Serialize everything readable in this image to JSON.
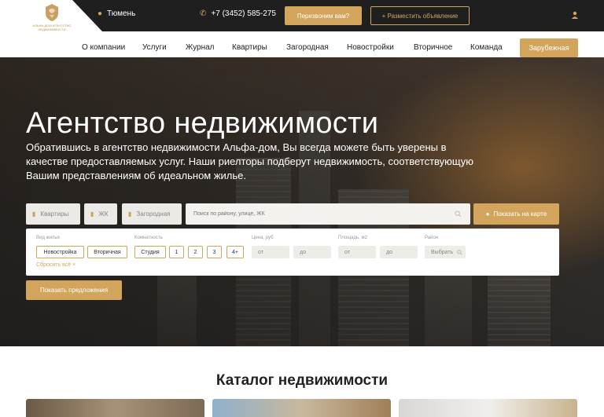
{
  "brand": {
    "logo_caption": "АЛЬФА-ДОМ АГЕНТСТВО НЕДВИЖИМОСТИ",
    "accent": "#d3a55c"
  },
  "topbar": {
    "city": "Тюмень",
    "phone": "+7 (3452) 585-275",
    "callback_label": "Перезвоним вам?",
    "post_label": "+ Разместить объявление"
  },
  "nav": {
    "items": [
      "О компании",
      "Услуги",
      "Журнал",
      "Квартиры",
      "Загородная",
      "Новостройки",
      "Вторичное",
      "Команда"
    ],
    "highlight": "Зарубежная"
  },
  "hero": {
    "title": "Агентство недвижимости",
    "description": "Обратившись в агентство недвижимости Альфа-дом, Вы всегда можете быть уверены в качестве предоставляемых услуг. Наши риелторы подберут недвижимость, соответствующую Вашим представлениям об идеальном жилье."
  },
  "search": {
    "tabs": [
      "Квартиры",
      "ЖК",
      "Загородная"
    ],
    "placeholder": "Поиск по району, улице, ЖК",
    "map_button": "Показать на карте"
  },
  "filters": {
    "housing_label": "Вид жилья",
    "housing_options": [
      "Новостройка",
      "Вторичная"
    ],
    "rooms_label": "Комнатность",
    "rooms_options": [
      "Студия",
      "1",
      "2",
      "3",
      "4+"
    ],
    "price_label": "Цена, руб",
    "area_label": "Площадь, м2",
    "from": "от",
    "to": "до",
    "district_label": "Район",
    "district_value": "Выбрать",
    "reset": "Сбросить всё ×",
    "show_button": "Показать предложения"
  },
  "catalog": {
    "title": "Каталог недвижимости"
  }
}
